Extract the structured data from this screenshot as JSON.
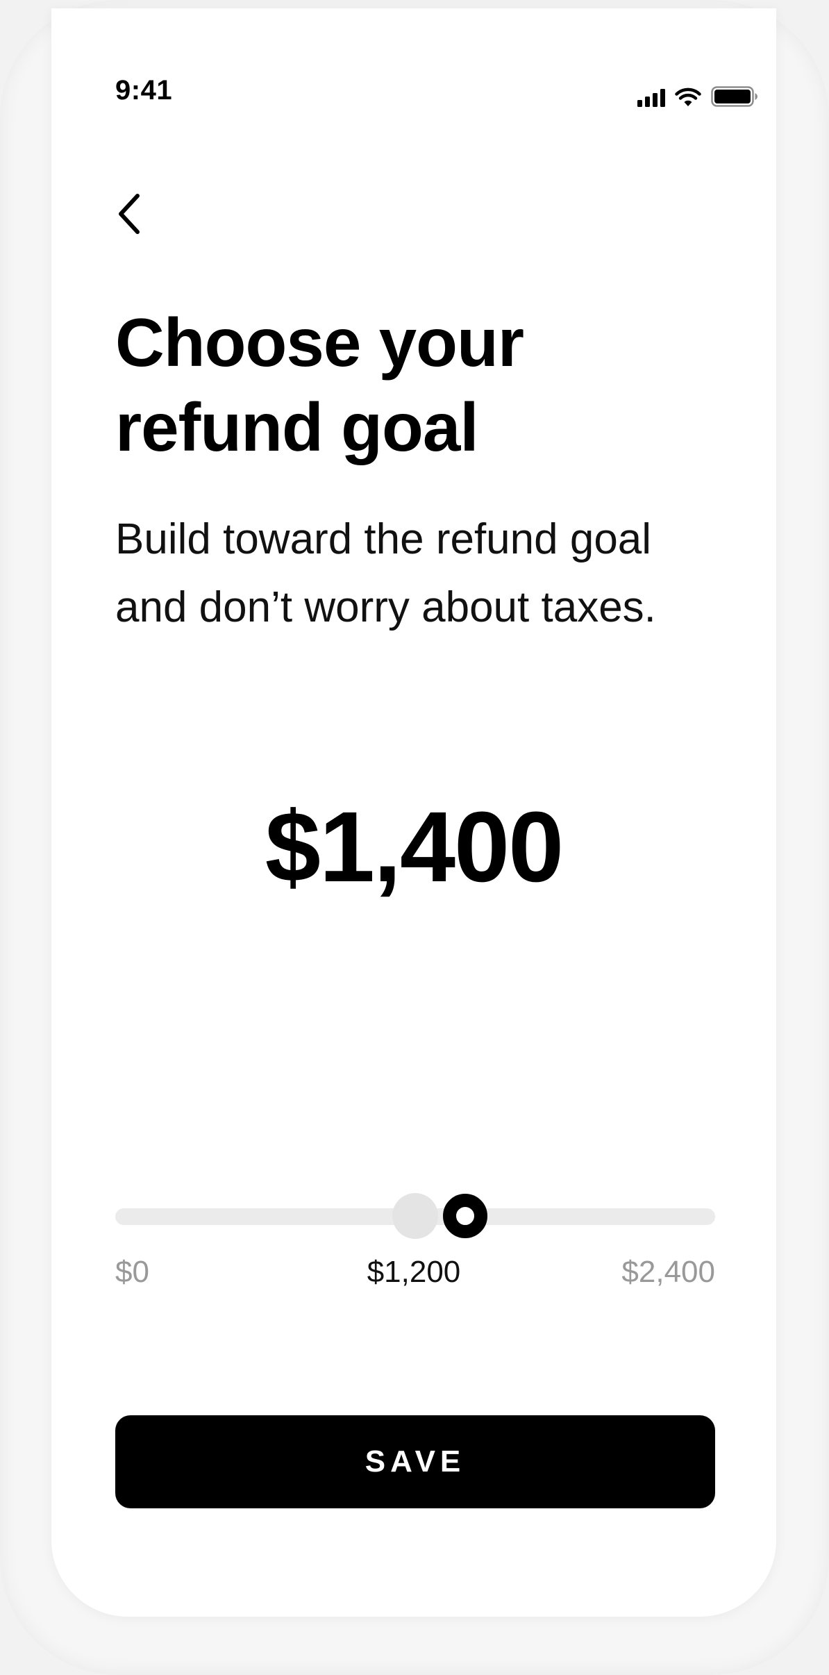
{
  "status_bar": {
    "time": "9:41",
    "icons": [
      "cellular-signal-icon",
      "wifi-icon",
      "battery-icon"
    ]
  },
  "nav": {
    "back_icon": "chevron-left-icon"
  },
  "header": {
    "title_line1": "Choose your",
    "title_line2": "refund goal",
    "subtitle_line1": "Build toward the refund goal",
    "subtitle_line2": "and don’t worry about taxes."
  },
  "goal": {
    "amount": "$1,400",
    "value": 1400
  },
  "slider": {
    "min_label": "$0",
    "mid_label": "$1,200",
    "max_label": "$2,400",
    "min": 0,
    "max": 2400,
    "value": 1400,
    "recommended": 1200
  },
  "actions": {
    "save_label": "SAVE"
  },
  "colors": {
    "accent": "#000000",
    "background": "#ffffff",
    "track": "#ebebeb",
    "muted_text": "#999999"
  }
}
